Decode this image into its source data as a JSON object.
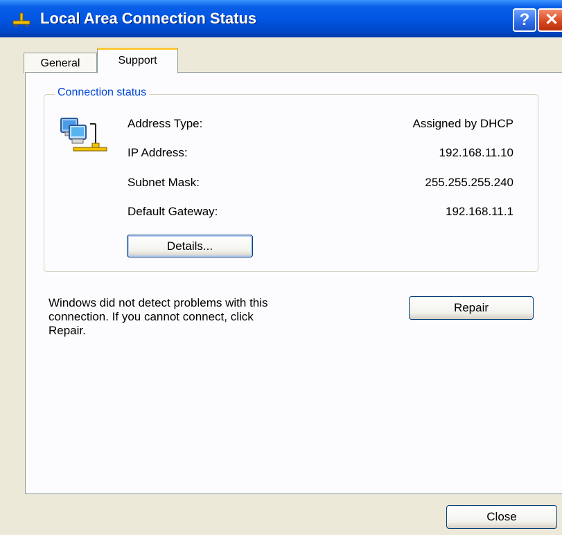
{
  "window": {
    "title": "Local Area Connection Status"
  },
  "titlebar": {
    "help_label": "?",
    "close_label": "✕"
  },
  "tabs": [
    {
      "label": "General",
      "selected": false
    },
    {
      "label": "Support",
      "selected": true
    }
  ],
  "connection_status": {
    "group_title": "Connection status",
    "rows": [
      {
        "label": "Address Type:",
        "value": "Assigned by DHCP"
      },
      {
        "label": "IP Address:",
        "value": "192.168.11.10"
      },
      {
        "label": "Subnet Mask:",
        "value": "255.255.255.240"
      },
      {
        "label": "Default Gateway:",
        "value": "192.168.11.1"
      }
    ],
    "details_button": "Details..."
  },
  "repair": {
    "message_lines": [
      "Windows did not detect problems with this",
      "connection. If you cannot connect, click",
      "Repair."
    ],
    "button": "Repair"
  },
  "footer": {
    "close_button": "Close"
  },
  "icons": [
    "network-connection-icon",
    "network-computers-icon"
  ],
  "colors": {
    "titlebar": "#0055E3",
    "dialog_bg": "#ECE9D8",
    "group_label": "#0046D5",
    "tab_highlight": "#FFC83C"
  }
}
